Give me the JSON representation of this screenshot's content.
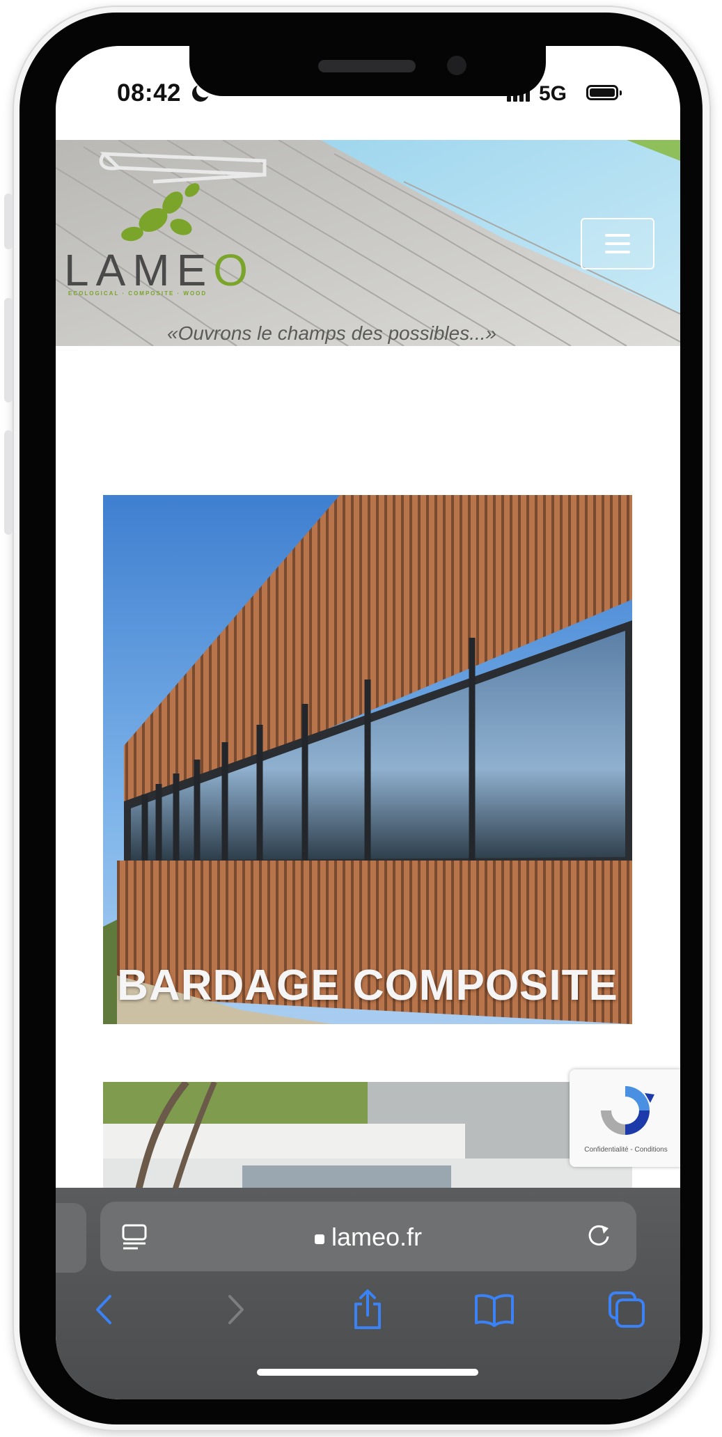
{
  "status_bar": {
    "time": "08:42",
    "network": "5G"
  },
  "site": {
    "logo_text_a": "LAME",
    "logo_text_b": "O",
    "logo_subtitle": "ECOLOGICAL · COMPOSITE · WOOD",
    "slogan": "«Ouvrons le champs des possibles...»",
    "cards": [
      {
        "title": "BARDAGE COMPOSITE"
      }
    ],
    "recaptcha": {
      "text": "Confidentialité - Conditions"
    }
  },
  "browser": {
    "url": "lameo.fr",
    "toolbar_icons": [
      "back-icon",
      "forward-icon",
      "share-icon",
      "bookmarks-icon",
      "tabs-icon"
    ]
  },
  "colors": {
    "brand_green": "#7aa42a",
    "safari_accent": "#3b82f6",
    "cladding_wood": "#b9744b"
  }
}
